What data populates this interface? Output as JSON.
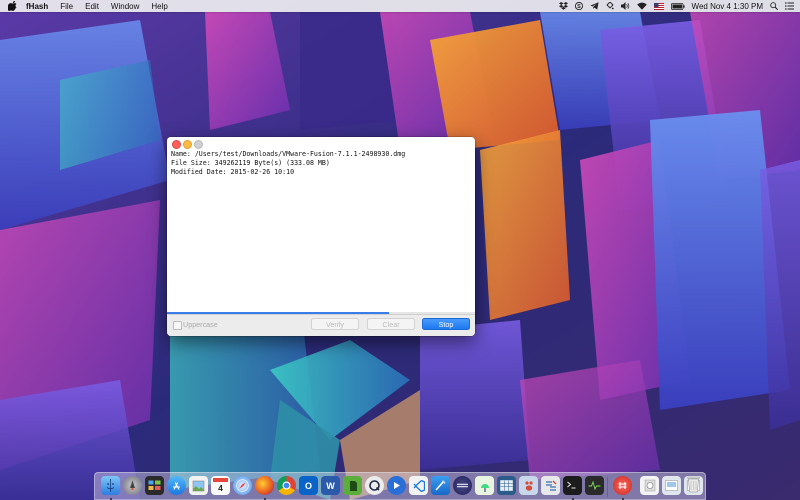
{
  "menubar": {
    "app_name": "fHash",
    "items": [
      "File",
      "Edit",
      "Window",
      "Help"
    ],
    "datetime": "Wed Nov 4  1:30 PM"
  },
  "window": {
    "content_lines": [
      "Name: /Users/test/Downloads/VMware-Fusion-7.1.1-2498930.dmg",
      "File Size: 349262119 Byte(s) (333.08 MB)",
      "Modified Date: 2015-02-26 10:10"
    ],
    "progress": 0.72,
    "uppercase_label": "Uppercase",
    "uppercase_checked": false,
    "verify_label": "Verify",
    "clear_label": "Clear",
    "stop_label": "Stop"
  },
  "dock": {
    "calendar_day": "4",
    "word_letter": "W",
    "outlook_letter": "O"
  },
  "colors": {
    "accent": "#1d79f0",
    "close": "#fc605c",
    "minimize": "#fdbc40"
  }
}
